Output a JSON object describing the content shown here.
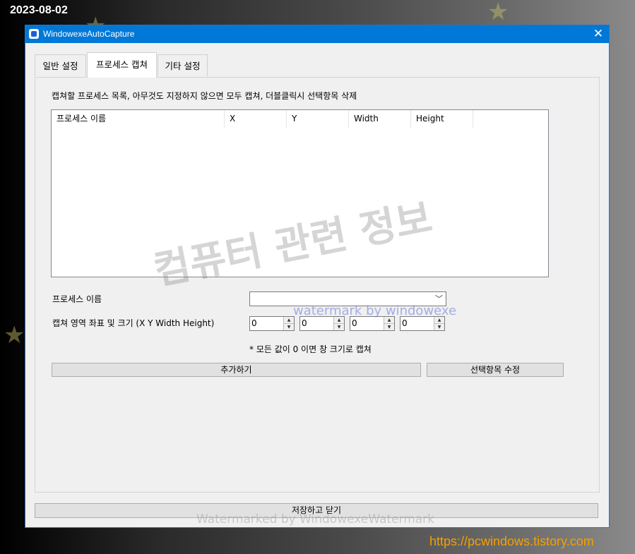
{
  "overlay": {
    "date": "2023-08-02",
    "url": "https://pcwindows.tistory.com",
    "watermark_big": "컴퓨터 관련 정보",
    "watermark_blue": "watermark by windowexe",
    "watermark_bottom": "Watermarked by WindowexeWatermark"
  },
  "window": {
    "title": "WindowexeAutoCapture",
    "close_glyph": "✕"
  },
  "tabs": [
    {
      "label": "일반 설정"
    },
    {
      "label": "프로세스 캡쳐"
    },
    {
      "label": "기타 설정"
    }
  ],
  "capture": {
    "hint": "캡쳐할 프로세스 목록, 아무것도 지정하지 않으면 모두 캡쳐, 더블클릭시 선택항목 삭제",
    "columns": [
      "프로세스 이름",
      "X",
      "Y",
      "Width",
      "Height"
    ],
    "process_name_label": "프로세스 이름",
    "process_name_value": "",
    "region_label": "캡쳐 영역 좌표 및 크기 (X Y Width Height)",
    "region_values": [
      "0",
      "0",
      "0",
      "0"
    ],
    "note": "* 모든 값이 0 이면 창 크기로 캡쳐",
    "add_label": "추가하기",
    "edit_label": "선택항목 수정"
  },
  "footer": {
    "save_label": "저장하고 닫기"
  },
  "colors": {
    "titlebar": "#0078d7",
    "url": "#f5a000",
    "active_tab": "#ffffff"
  }
}
